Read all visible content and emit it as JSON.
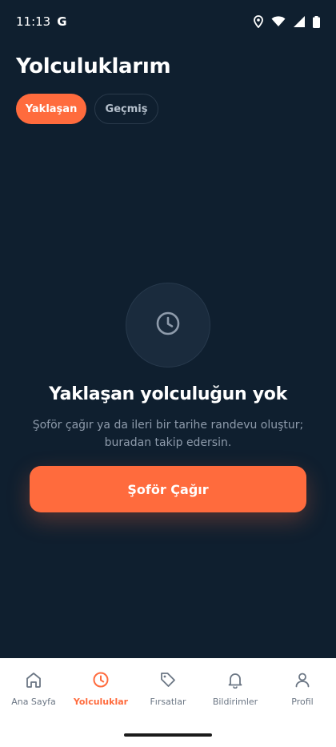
{
  "status_bar": {
    "time": "11:13",
    "g_logo": "G",
    "icons": [
      "location-icon",
      "wifi-icon",
      "signal-icon",
      "battery-icon"
    ]
  },
  "page": {
    "title": "Yolculuklarım"
  },
  "tabs": [
    {
      "label": "Yaklaşan",
      "active": true
    },
    {
      "label": "Geçmiş",
      "active": false
    }
  ],
  "empty_state": {
    "icon": "clock-icon",
    "title": "Yaklaşan yolculuğun yok",
    "description_line1": "Şoför çağır ya da ileri bir tarihe randevu oluştur;",
    "description_line2": "buradan takip edersin."
  },
  "cta": {
    "label": "Şoför Çağır"
  },
  "bottom_nav": [
    {
      "label": "Ana Sayfa",
      "icon": "home-icon",
      "active": false
    },
    {
      "label": "Yolculuklar",
      "icon": "clock-icon",
      "active": true
    },
    {
      "label": "Fırsatlar",
      "icon": "tag-icon",
      "active": false
    },
    {
      "label": "Bildirimler",
      "icon": "bell-icon",
      "active": false
    },
    {
      "label": "Profil",
      "icon": "user-icon",
      "active": false
    }
  ],
  "colors": {
    "background": "#0f1f2f",
    "accent": "#ff6b3d",
    "nav_background": "#ffffff",
    "muted_text": "#8e9bab"
  }
}
